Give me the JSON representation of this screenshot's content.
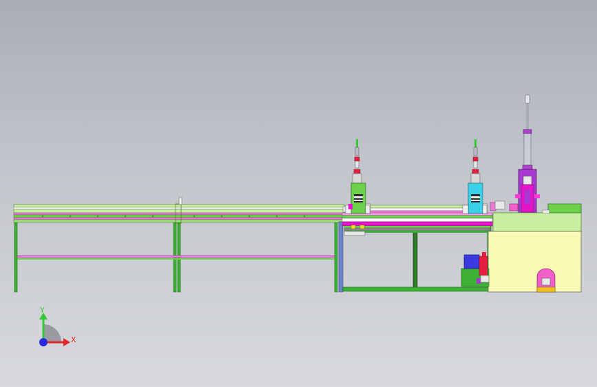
{
  "view": {
    "background_top": "#a9adb6",
    "background_bottom": "#d7d9dd"
  },
  "palette": {
    "frame_green": "#3cb034",
    "rail_pink": "#e879d6",
    "rail_light_green": "#c9f0a0",
    "steel_blue": "#6f84c8",
    "press_green": "#6cd04a",
    "press_cyan": "#3ad0e8",
    "press_purple": "#a63ad0",
    "magenta": "#e016c8",
    "cabinet_yellow": "#fafab4",
    "motor_blue": "#3a3ae0",
    "door_pink": "#f060c8",
    "rod_grey": "#b8bcc4"
  },
  "axis_triad": {
    "y_label": "Y",
    "x_label": "X",
    "y_color": "#34c834",
    "x_color": "#e02828",
    "z_color": "#2828e0"
  }
}
